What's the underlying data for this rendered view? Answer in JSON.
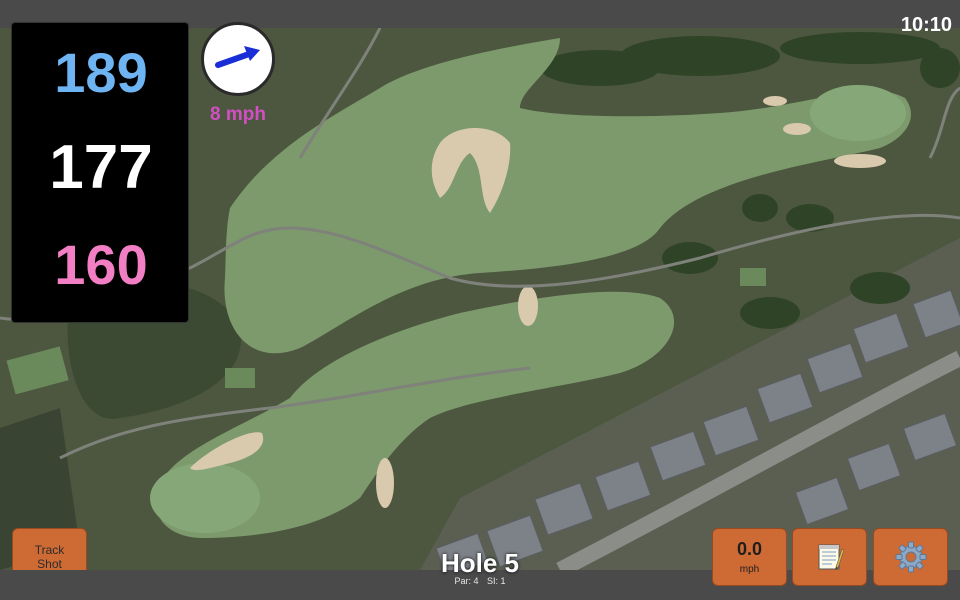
{
  "status_bar": {
    "time": "10:10"
  },
  "distances": {
    "back": "189",
    "middle": "177",
    "front": "160"
  },
  "wind": {
    "speed_text": "8 mph",
    "direction_icon": "arrow-icon"
  },
  "hole": {
    "title": "Hole 5",
    "par": "Par: 4",
    "si": "SI: 1"
  },
  "buttons": {
    "track_line1": "Track",
    "track_line2": "Shot",
    "speed_value": "0.0",
    "speed_unit": "mph",
    "notes_icon": "notepad-icon",
    "settings_icon": "gear-icon"
  },
  "colors": {
    "back": "#6fb4f2",
    "middle": "#ffffff",
    "front": "#f27fc4",
    "wind_text": "#d24ec3",
    "button": "#ce6b35"
  }
}
